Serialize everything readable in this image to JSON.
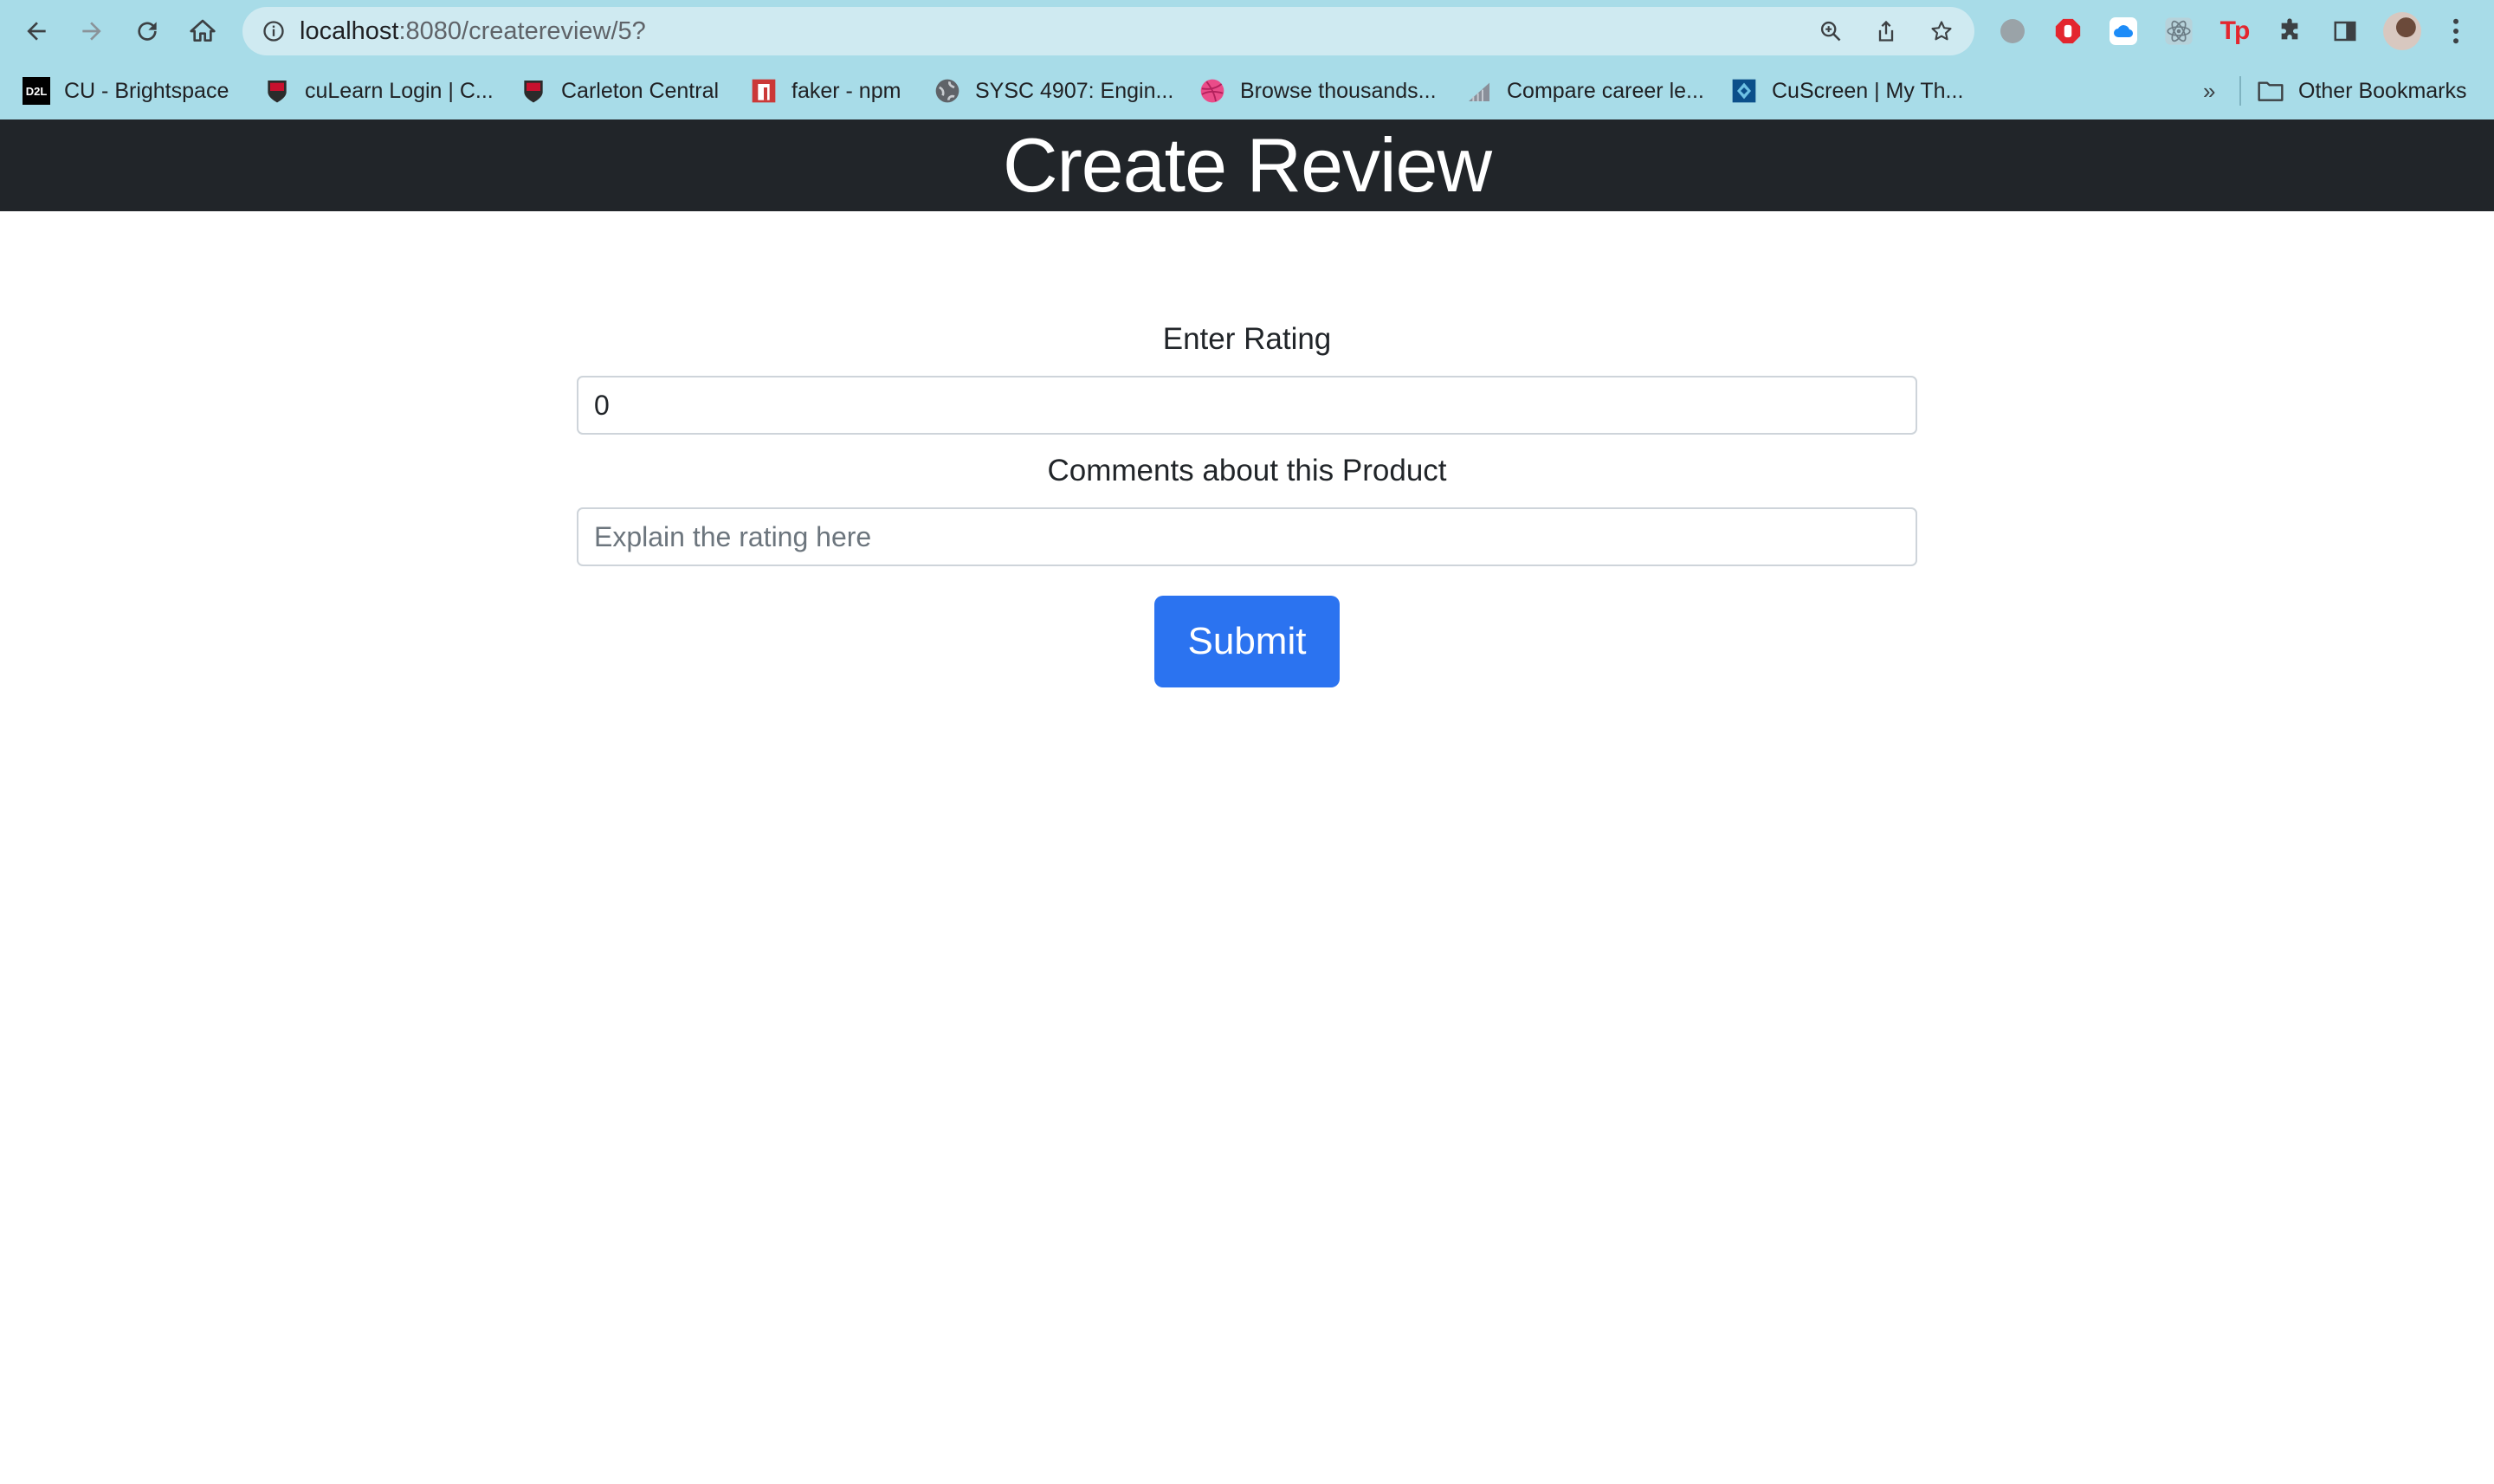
{
  "browser": {
    "url_host": "localhost",
    "url_rest": ":8080/createreview/5?",
    "icons": {
      "back": "back-arrow-icon",
      "forward": "forward-arrow-icon",
      "reload": "reload-icon",
      "home": "home-icon",
      "site_info": "info-icon",
      "zoom": "zoom-icon",
      "share": "share-icon",
      "bookmark_star": "star-icon",
      "menu": "kebab-menu-icon"
    },
    "bookmarks": [
      {
        "label": "CU - Brightspace",
        "icon": "d2l-icon",
        "color": "#000000"
      },
      {
        "label": "cuLearn Login | C...",
        "icon": "carleton-icon",
        "color": "#c8102e"
      },
      {
        "label": "Carleton Central",
        "icon": "carleton-icon",
        "color": "#c8102e"
      },
      {
        "label": "faker - npm",
        "icon": "npm-icon",
        "color": "#cb3837"
      },
      {
        "label": "SYSC 4907: Engin...",
        "icon": "globe-icon",
        "color": "#555555"
      },
      {
        "label": "Browse thousands...",
        "icon": "dribbble-icon",
        "color": "#ea4c89"
      },
      {
        "label": "Compare career le...",
        "icon": "chart-icon",
        "color": "#8a8f99"
      },
      {
        "label": "CuScreen | My Th...",
        "icon": "cuscreen-icon",
        "color": "#0b4f8a"
      }
    ],
    "overflow": "»",
    "other_bookmarks": "Other Bookmarks"
  },
  "page": {
    "title": "Create Review",
    "rating_label": "Enter Rating",
    "rating_value": "0",
    "comments_label": "Comments about this Product",
    "comments_placeholder": "Explain the rating here",
    "submit_label": "Submit",
    "colors": {
      "header_bg": "#212529",
      "button_bg": "#2b73f0",
      "chrome_bg": "#a8dce8"
    }
  }
}
